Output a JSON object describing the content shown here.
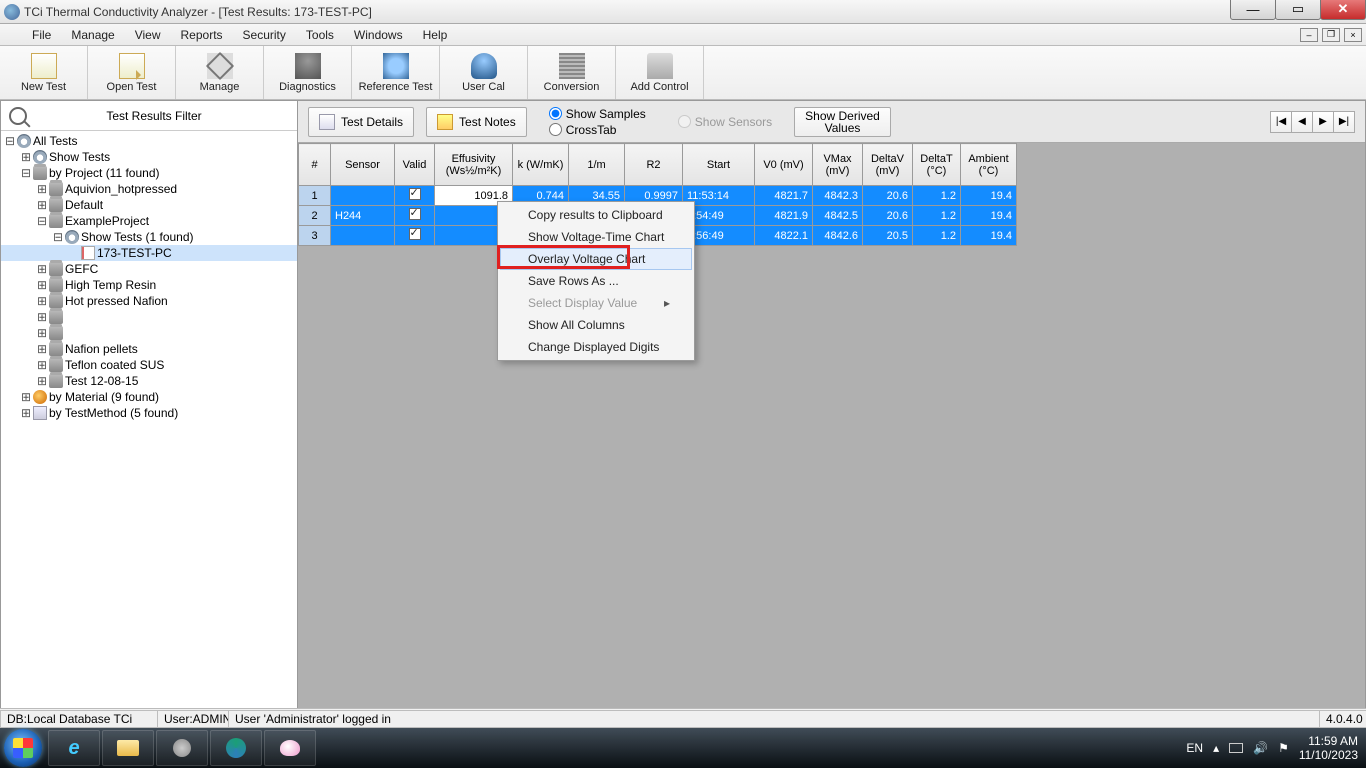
{
  "window": {
    "title": "TCi Thermal Conductivity Analyzer - [Test Results: 173-TEST-PC]"
  },
  "menubar": [
    "File",
    "Manage",
    "View",
    "Reports",
    "Security",
    "Tools",
    "Windows",
    "Help"
  ],
  "toolbar": [
    {
      "id": "new-test",
      "label": "New Test",
      "icon": "ic-new"
    },
    {
      "id": "open-test",
      "label": "Open Test",
      "icon": "ic-open"
    },
    {
      "id": "manage",
      "label": "Manage",
      "icon": "ic-mgr"
    },
    {
      "id": "diagnostics",
      "label": "Diagnostics",
      "icon": "ic-diag"
    },
    {
      "id": "reference-test",
      "label": "Reference Test",
      "icon": "ic-ref"
    },
    {
      "id": "user-cal",
      "label": "User Cal",
      "icon": "ic-user"
    },
    {
      "id": "conversion",
      "label": "Conversion",
      "icon": "ic-conv"
    },
    {
      "id": "add-control",
      "label": "Add Control",
      "icon": "ic-ctrl"
    }
  ],
  "tree_filter_label": "Test Results Filter",
  "tree": [
    {
      "ind": 0,
      "tw": "⊟",
      "ic": "ci-dial",
      "label": "All Tests"
    },
    {
      "ind": 1,
      "tw": "⊞",
      "ic": "ci-dial",
      "label": "Show Tests"
    },
    {
      "ind": 1,
      "tw": "⊟",
      "ic": "ci-can",
      "label": "by Project (11 found)"
    },
    {
      "ind": 2,
      "tw": "⊞",
      "ic": "ci-can",
      "label": "Aquivion_hotpressed"
    },
    {
      "ind": 2,
      "tw": "⊞",
      "ic": "ci-can",
      "label": "Default"
    },
    {
      "ind": 2,
      "tw": "⊟",
      "ic": "ci-can",
      "label": "ExampleProject"
    },
    {
      "ind": 3,
      "tw": "⊟",
      "ic": "ci-dial",
      "label": "Show Tests (1 found)"
    },
    {
      "ind": 4,
      "tw": "",
      "ic": "ci-doc",
      "label": "173-TEST-PC",
      "selected": true
    },
    {
      "ind": 2,
      "tw": "⊞",
      "ic": "ci-can",
      "label": "GEFC"
    },
    {
      "ind": 2,
      "tw": "⊞",
      "ic": "ci-can",
      "label": "High Temp Resin"
    },
    {
      "ind": 2,
      "tw": "⊞",
      "ic": "ci-can",
      "label": "Hot pressed Nafion"
    },
    {
      "ind": 2,
      "tw": "⊞",
      "ic": "ci-can",
      "label": "​"
    },
    {
      "ind": 2,
      "tw": "⊞",
      "ic": "ci-can",
      "label": "​"
    },
    {
      "ind": 2,
      "tw": "⊞",
      "ic": "ci-can",
      "label": "Nafion pellets"
    },
    {
      "ind": 2,
      "tw": "⊞",
      "ic": "ci-can",
      "label": "Teflon coated SUS"
    },
    {
      "ind": 2,
      "tw": "⊞",
      "ic": "ci-can",
      "label": "Test 12-08-15"
    },
    {
      "ind": 1,
      "tw": "⊞",
      "ic": "ci-mat",
      "label": "by Material (9 found)"
    },
    {
      "ind": 1,
      "tw": "⊞",
      "ic": "ci-rep",
      "label": "by TestMethod (5 found)"
    }
  ],
  "det": {
    "test_details": "Test Details",
    "test_notes": "Test Notes",
    "show_samples": "Show Samples",
    "crosstab": "CrossTab",
    "show_sensors": "Show Sensors",
    "show_derived": "Show Derived\nValues"
  },
  "grid": {
    "headers": [
      "#",
      "Sensor",
      "Valid",
      "Effusivity (Ws½/m²K)",
      "k (W/mK)",
      "1/m",
      "R2",
      "Start",
      "V0 (mV)",
      "VMax (mV)",
      "DeltaV (mV)",
      "DeltaT (°C)",
      "Ambient (°C)"
    ],
    "rows": [
      {
        "idx": "1",
        "sensor": "",
        "valid": true,
        "eff": "1091.8",
        "k": "0.744",
        "inv": "34.55",
        "r2": "0.9997",
        "start": "11:53:14",
        "v0": "4821.7",
        "vmax": "4842.3",
        "dv": "20.6",
        "dt": "1.2",
        "amb": "19.4"
      },
      {
        "idx": "2",
        "sensor": "H244",
        "valid": true,
        "eff": "",
        "k": "",
        "inv": "",
        "r2": "",
        "start": "1:54:49",
        "v0": "4821.9",
        "vmax": "4842.5",
        "dv": "20.6",
        "dt": "1.2",
        "amb": "19.4"
      },
      {
        "idx": "3",
        "sensor": "",
        "valid": true,
        "eff": "",
        "k": "",
        "inv": "",
        "r2": "",
        "start": "1:56:49",
        "v0": "4822.1",
        "vmax": "4842.6",
        "dv": "20.5",
        "dt": "1.2",
        "amb": "19.4"
      }
    ]
  },
  "context_menu": {
    "items": [
      {
        "label": "Copy results to Clipboard"
      },
      {
        "label": "Show Voltage-Time Chart"
      },
      {
        "label": "Overlay Voltage Chart",
        "highlight": true
      },
      {
        "label": "Save Rows As ..."
      },
      {
        "label": "Select Display Value",
        "disabled": true,
        "submenu": true
      },
      {
        "label": "Show All Columns"
      },
      {
        "label": "Change Displayed Digits"
      }
    ]
  },
  "status": {
    "db": "DB:Local Database TCi",
    "user": "User:ADMIN",
    "msg": "User 'Administrator' logged in",
    "ver": "4.0.4.0"
  },
  "taskbar": {
    "lang": "EN",
    "time": "11:59 AM",
    "date": "11/10/2023"
  }
}
